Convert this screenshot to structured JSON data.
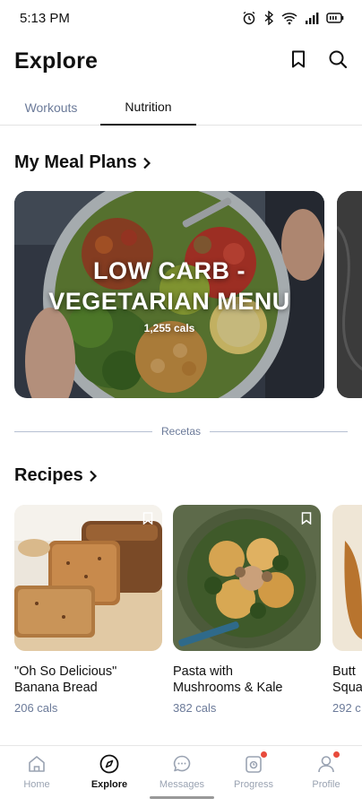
{
  "status_bar": {
    "time": "5:13 PM"
  },
  "header": {
    "title": "Explore"
  },
  "tabs": [
    {
      "label": "Workouts",
      "active": false
    },
    {
      "label": "Nutrition",
      "active": true
    }
  ],
  "meal_plans": {
    "title": "My Meal Plans",
    "card": {
      "name_line1": "LOW CARB -",
      "name_line2": "VEGETARIAN MENU",
      "cals": "1,255 cals"
    }
  },
  "divider": {
    "label": "Recetas"
  },
  "recipes": {
    "title": "Recipes",
    "items": [
      {
        "name_line1": "\"Oh So Delicious\"",
        "name_line2": "Banana Bread",
        "cals": "206 cals"
      },
      {
        "name_line1": "Pasta with",
        "name_line2": "Mushrooms & Kale",
        "cals": "382 cals"
      },
      {
        "name_line1": "Butt",
        "name_line2": "Squa",
        "cals": "292 c"
      }
    ]
  },
  "bottom_nav": [
    {
      "label": "Home",
      "icon": "home-icon",
      "active": false
    },
    {
      "label": "Explore",
      "icon": "compass-icon",
      "active": true
    },
    {
      "label": "Messages",
      "icon": "message-icon",
      "active": false
    },
    {
      "label": "Progress",
      "icon": "progress-icon",
      "active": false,
      "badge": true
    },
    {
      "label": "Profile",
      "icon": "profile-icon",
      "active": false,
      "badge": true
    }
  ],
  "colors": {
    "accent_text": "#6b7a99",
    "badge": "#e84b3c",
    "divider": "#b6c0d2"
  }
}
